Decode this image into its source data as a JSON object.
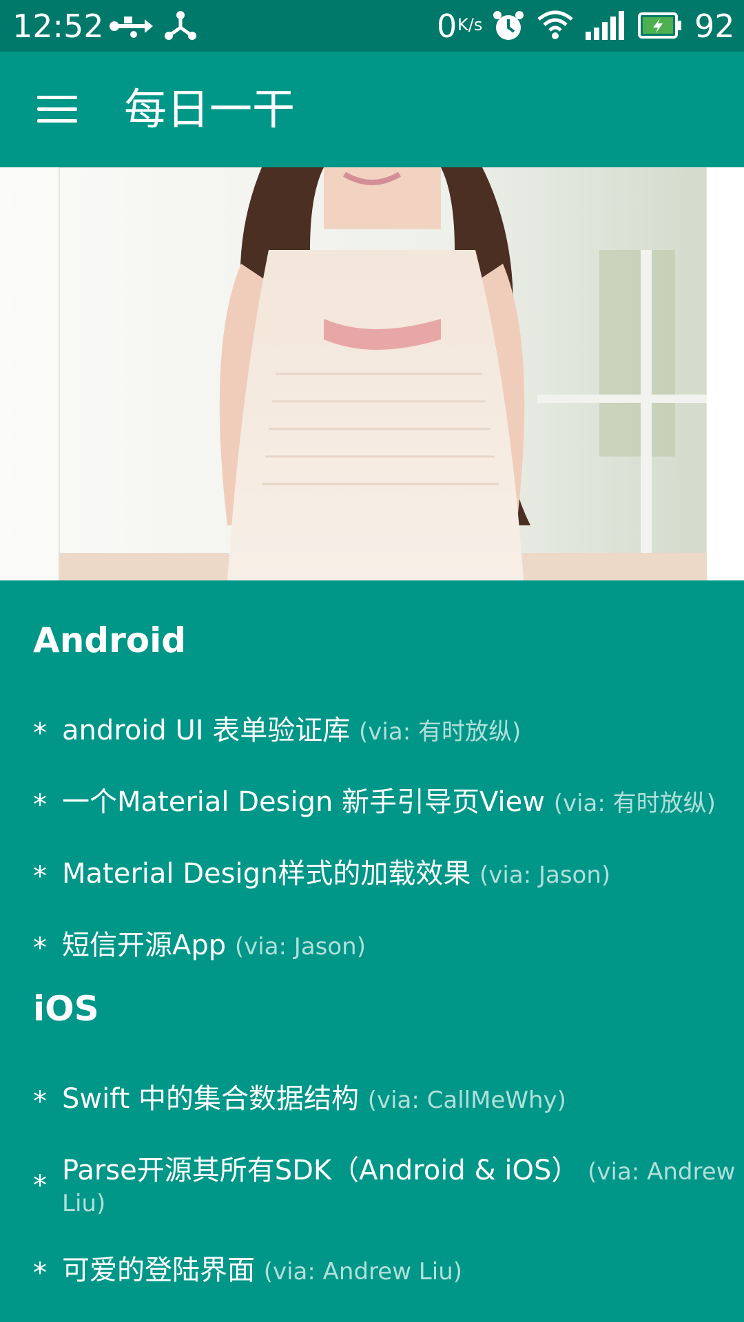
{
  "status_bar": {
    "time": "12:52",
    "icons": [
      "usb-icon",
      "share-node-icon",
      "alarm-icon",
      "wifi-icon",
      "signal-icon",
      "battery-charging-icon"
    ],
    "net_speed": "0",
    "net_speed_unit": "K/s",
    "battery_percent": "92"
  },
  "app_bar": {
    "title": "每日一干",
    "menu_icon": "hamburger-menu-icon"
  },
  "hero_image": {
    "description_icon": "photo"
  },
  "sections": [
    {
      "title": "Android",
      "items": [
        {
          "text": "android UI 表单验证库",
          "via": "(via: 有时放纵)"
        },
        {
          "text": "一个Material Design 新手引导页View",
          "via": "(via: 有时放纵)"
        },
        {
          "text": "Material Design样式的加载效果",
          "via": "(via: Jason)"
        },
        {
          "text": "短信开源App",
          "via": "(via: Jason)"
        }
      ]
    },
    {
      "title": "iOS",
      "items": [
        {
          "text": "Swift 中的集合数据结构",
          "via": "(via: CallMeWhy)"
        },
        {
          "text": "Parse开源其所有SDK（Android & iOS）",
          "via": "(via: Andrew Liu)"
        },
        {
          "text": "可爱的登陆界面",
          "via": "(via: Andrew Liu)"
        }
      ]
    }
  ],
  "bullet": "*",
  "colors": {
    "primary": "#009688",
    "primary_dark": "#00796b",
    "via_text": "#b2dfdb"
  }
}
